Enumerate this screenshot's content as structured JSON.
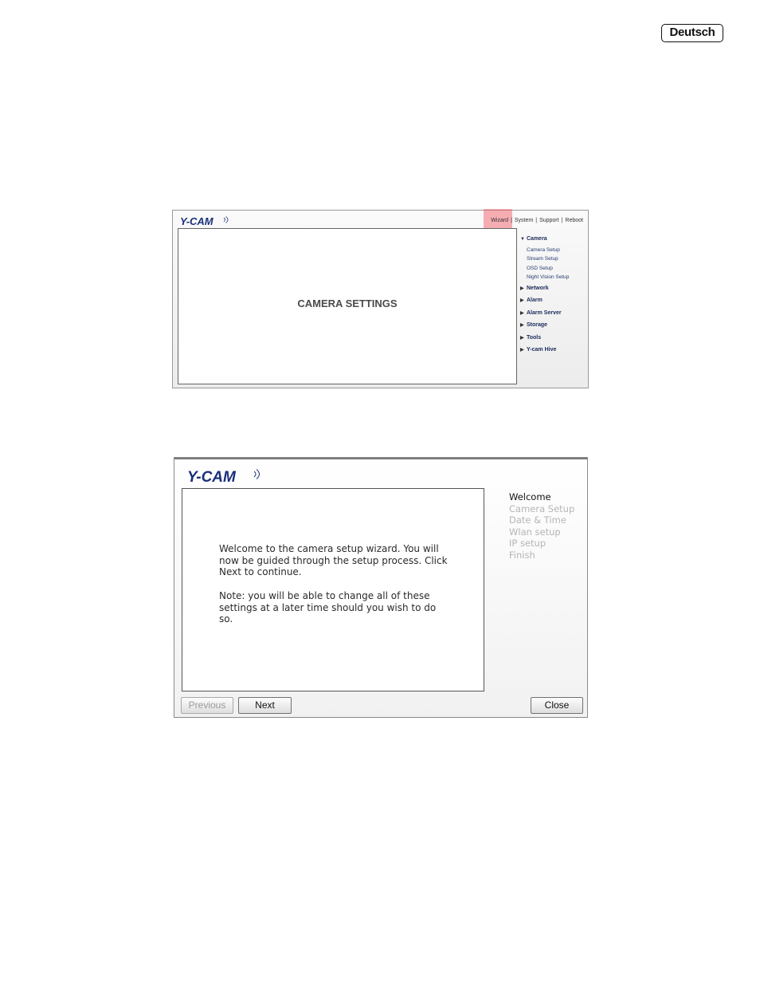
{
  "page": {
    "language_badge": "Deutsch"
  },
  "camera_page": {
    "logo_text": "Y-CAM",
    "top_nav": [
      "Wizard",
      "System",
      "Support",
      "Reboot"
    ],
    "content_title": "CAMERA SETTINGS",
    "menu": {
      "camera": {
        "label": "Camera",
        "expanded": true,
        "items": [
          "Camera Setup",
          "Stream Setup",
          "OSD Setup",
          "Night Vision Setup"
        ]
      },
      "network": "Network",
      "alarm": "Alarm",
      "alarm_server": "Alarm Server",
      "storage": "Storage",
      "tools": "Tools",
      "ycam_hive": "Y-cam Hive"
    },
    "highlight_color": "#f0505a"
  },
  "wizard": {
    "logo_text": "Y-CAM",
    "welcome_text": "Welcome to the camera setup wizard. You will now be guided through the setup process. Click Next to continue.",
    "note_text": "Note: you will be able to change all of these settings at a later time should you wish to do so.",
    "steps": [
      "Welcome",
      "Camera Setup",
      "Date & Time",
      "Wlan setup",
      "IP setup",
      "Finish"
    ],
    "active_step": "Welcome",
    "buttons": {
      "previous": "Previous",
      "next": "Next",
      "close": "Close"
    },
    "brand_color": "#1a2f7a"
  }
}
